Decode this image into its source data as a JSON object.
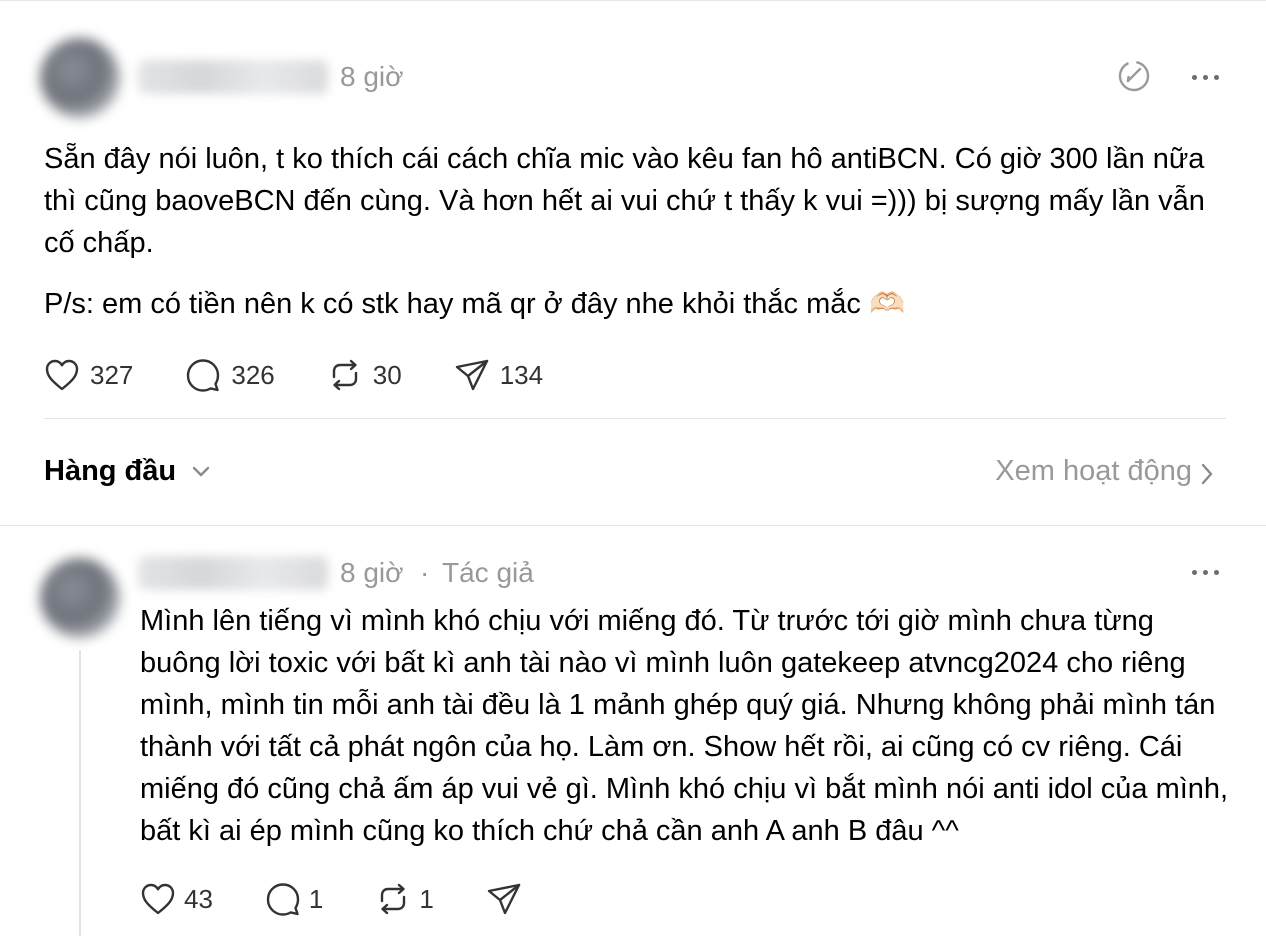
{
  "post": {
    "time": "8 giờ",
    "body": "Sẵn đây nói luôn, t ko thích cái cách chĩa mic vào kêu fan hô antiBCN. Có giờ 300 lần nữa thì cũng baoveBCN đến cùng. Và hơn hết ai vui chứ t thấy k vui =))) bị sượng mấy lần vẫn cố chấp.",
    "ps": "P/s: em có tiền nên k có stk hay mã qr ở đây nhe khỏi thắc mắc 🫶🏻",
    "likes": "327",
    "comments": "326",
    "reposts": "30",
    "shares": "134"
  },
  "sort": {
    "label": "Hàng đầu",
    "activity_link": "Xem hoạt động"
  },
  "reply": {
    "time": "8 giờ",
    "separator": "·",
    "author_tag": "Tác giả",
    "body": "Mình lên tiếng vì mình khó chịu với miếng đó. Từ trước tới giờ mình chưa từng buông lời toxic với bất kì anh tài nào vì mình luôn gatekeep atvncg2024 cho riêng mình, mình tin mỗi anh tài đều là 1 mảnh ghép quý giá. Nhưng không phải mình tán thành với tất cả phát ngôn của họ. Làm ơn. Show hết rồi, ai cũng có cv riêng. Cái miếng đó cũng chả ấm áp vui vẻ gì. Mình khó chịu vì bắt mình nói anti idol của mình, bất kì ai ép mình cũng ko thích chứ chả cần anh A anh B đâu ^^",
    "likes": "43",
    "comments": "1",
    "reposts": "1"
  },
  "icons": {
    "like": "heart-icon",
    "comment": "speech-bubble-icon",
    "repost": "repost-icon",
    "share": "paper-plane-icon",
    "more": "more-dots-icon",
    "activity": "activity-circle-icon"
  },
  "colors": {
    "text": "#000000",
    "muted": "#999999",
    "icon": "#333333",
    "divider": "#e2e2e2"
  }
}
